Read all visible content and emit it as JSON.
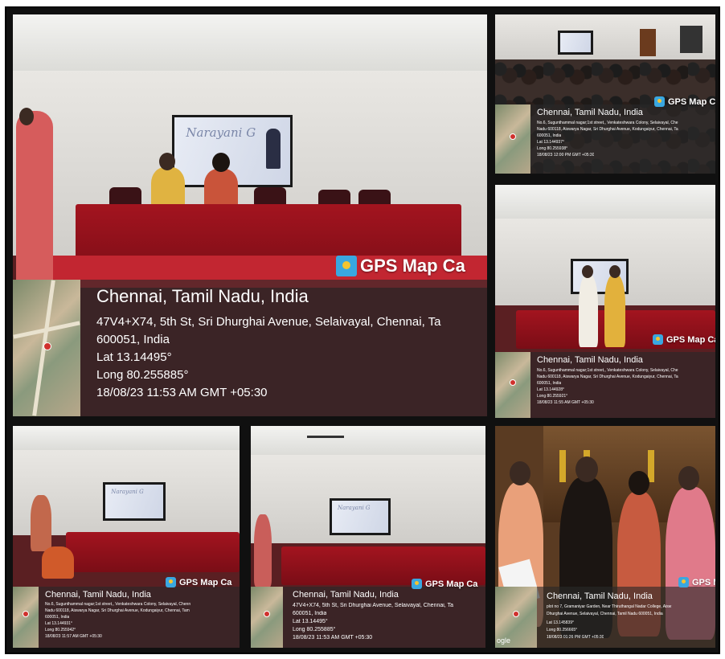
{
  "badge_text": "GPS Map Ca",
  "badge_text_short": "GPS M",
  "photos": {
    "main": {
      "screen_name": "Narayani G",
      "location": "Chennai, Tamil Nadu, India",
      "address_line1": "47V4+X74, 5th St, Sri Dhurghai Avenue, Selaivayal, Chennai, Ta",
      "address_line2": "600051, India",
      "lat": "Lat 13.14495°",
      "long": "Long 80.255885°",
      "datetime": "18/08/23 11:53 AM GMT +05:30"
    },
    "top_right": {
      "location": "Chennai, Tamil Nadu, India",
      "address_line1": "No.6, Sugunthammal nagar;1st street,, Venkateshwara Colony, Selaivayal, Che",
      "address_line2": "Nadu 600118, Aiswarya Nagar, Sri Dhurghai Avenue, Kodungaiyur, Chennai, Ta",
      "address_line3": "600051, India",
      "lat": "Lat 13.144937°",
      "long": "Long 80.255938°",
      "datetime": "18/08/23 12:00 PM GMT +05:30"
    },
    "mid_right": {
      "location": "Chennai, Tamil Nadu, India",
      "address_line1": "No.6, Sugunthammal nagar;1st street,, Venkateshwara Colony, Selaivayal, Che",
      "address_line2": "Nadu 600118, Aiswarya Nagar, Sri Dhurghai Avenue, Kodungaiyur, Chennai, Ta",
      "address_line3": "600051, India",
      "lat": "Lat 13.144928°",
      "long": "Long 80.255921°",
      "datetime": "18/08/23 11:55 AM GMT +05:30"
    },
    "bottom_left": {
      "location": "Chennai, Tamil Nadu, India",
      "address_line1": "No.6, Sugunthammal nagar;1st street,, Venkateshwara Colony, Selaivayal, Chenn",
      "address_line2": "Nadu 600118, Aiswarya Nagar, Sri Dhurghai Avenue, Kodungaiyur, Chennai, Tam",
      "address_line3": "600051, India",
      "lat": "Lat 13.144931°",
      "long": "Long 80.255942°",
      "datetime": "18/08/23 11:57 AM GMT +05:30"
    },
    "bottom_mid": {
      "location": "Chennai, Tamil Nadu, India",
      "address_line1": "47V4+X74, 5th St, Sri Dhurghai Avenue, Selaivayal, Chennai, Ta",
      "address_line2": "600051, India",
      "lat": "Lat 13.14495°",
      "long": "Long 80.255885°",
      "datetime": "18/08/23 11:53 AM GMT +05:30"
    },
    "bottom_right": {
      "location": "Chennai, Tamil Nadu, India",
      "address_line1": "plot no 7, Gramaniyar Garden, Near Thiruthangal Nadar College, Aisw",
      "address_line2": "Dhurghai Avenue, Selaivayal, Chennai, Tamil Nadu 600051, India",
      "lat": "Lat 13.145839°",
      "long": "Long 80.256665°",
      "datetime": "18/08/23 01:26 PM GMT +05:30",
      "google": "ogle"
    }
  },
  "colors": {
    "table_red": "#a3141f",
    "overlay": "#282828",
    "badge_icon": "#3aa7e0"
  }
}
